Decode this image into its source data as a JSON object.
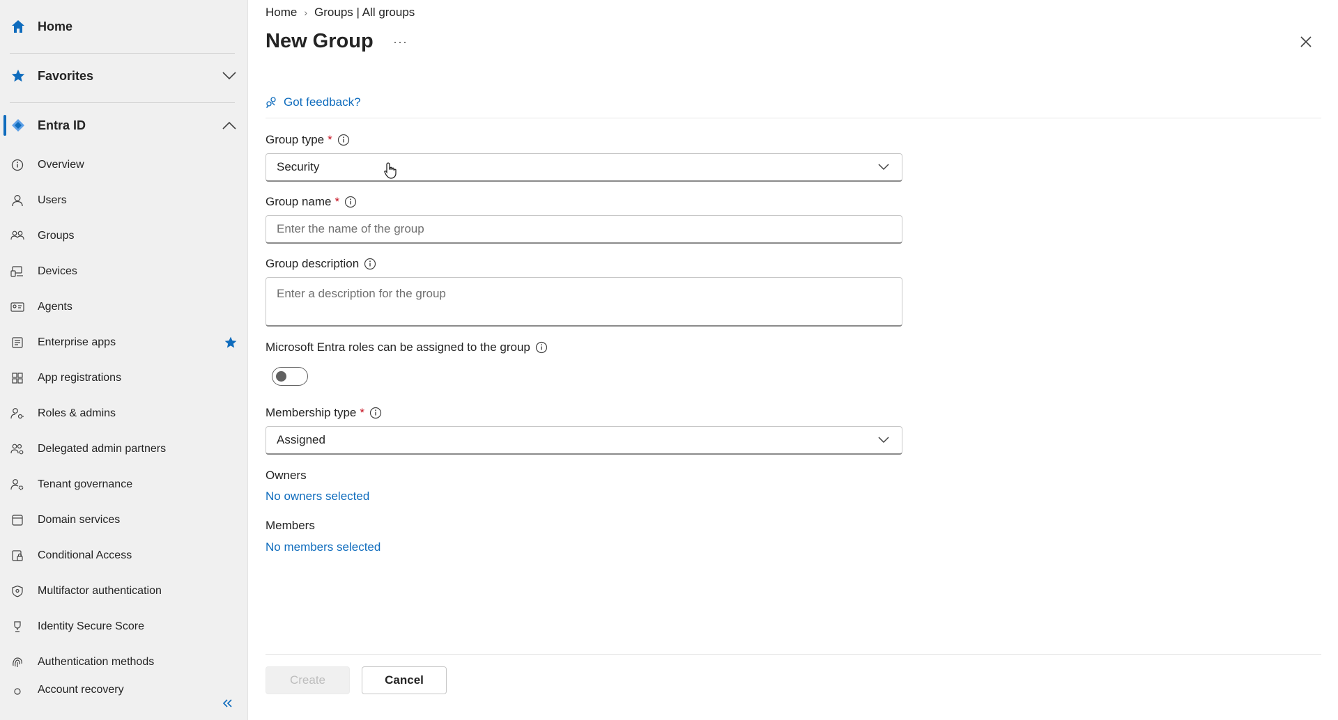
{
  "sidebar": {
    "home": "Home",
    "favorites": "Favorites",
    "section": "Entra ID",
    "items": [
      {
        "label": "Overview",
        "icon": "info-circle-icon"
      },
      {
        "label": "Users",
        "icon": "person-icon"
      },
      {
        "label": "Groups",
        "icon": "people-icon"
      },
      {
        "label": "Devices",
        "icon": "devices-icon"
      },
      {
        "label": "Agents",
        "icon": "agent-icon"
      },
      {
        "label": "Enterprise apps",
        "icon": "apps-icon",
        "favorited": true
      },
      {
        "label": "App registrations",
        "icon": "grid-icon"
      },
      {
        "label": "Roles & admins",
        "icon": "person-key-icon"
      },
      {
        "label": "Delegated admin partners",
        "icon": "people-settings-icon"
      },
      {
        "label": "Tenant governance",
        "icon": "person-gear-icon"
      },
      {
        "label": "Domain services",
        "icon": "window-icon"
      },
      {
        "label": "Conditional Access",
        "icon": "lock-device-icon"
      },
      {
        "label": "Multifactor authentication",
        "icon": "shield-icon"
      },
      {
        "label": "Identity Secure Score",
        "icon": "trophy-icon"
      },
      {
        "label": "Authentication methods",
        "icon": "fingerprint-icon"
      },
      {
        "label": "Account recovery",
        "icon": "recovery-icon"
      }
    ]
  },
  "breadcrumb": {
    "home": "Home",
    "groups": "Groups | All groups"
  },
  "page": {
    "title": "New Group",
    "more": "···"
  },
  "feedback": "Got feedback?",
  "form": {
    "group_type_label": "Group type",
    "group_type_value": "Security",
    "group_name_label": "Group name",
    "group_name_placeholder": "Enter the name of the group",
    "group_desc_label": "Group description",
    "group_desc_placeholder": "Enter a description for the group",
    "roles_label": "Microsoft Entra roles can be assigned to the group",
    "roles_toggle_on": false,
    "membership_label": "Membership type",
    "membership_value": "Assigned",
    "owners_label": "Owners",
    "owners_link": "No owners selected",
    "members_label": "Members",
    "members_link": "No members selected",
    "required_mark": "*"
  },
  "buttons": {
    "create": "Create",
    "cancel": "Cancel"
  },
  "colors": {
    "accent": "#0f6cbd",
    "required": "#c50f1f",
    "sidebar_bg": "#f0f0f0"
  }
}
